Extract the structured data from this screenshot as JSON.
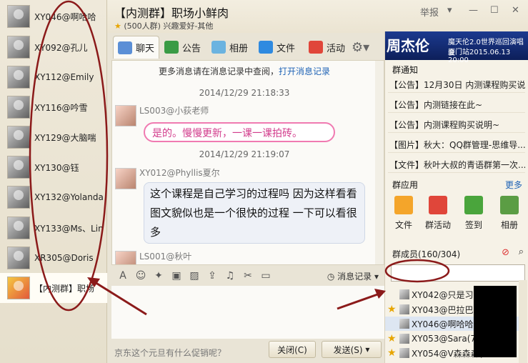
{
  "contacts": [
    {
      "name": "XY046@啊哈哈"
    },
    {
      "name": "XY092@孔儿"
    },
    {
      "name": "XY112@Emily"
    },
    {
      "name": "XY116@吟雪"
    },
    {
      "name": "XY129@大脑喘"
    },
    {
      "name": "XY130@钰"
    },
    {
      "name": "XY132@Yolanda"
    },
    {
      "name": "XY133@Ms、Lin"
    },
    {
      "name": "XR305@Doris"
    },
    {
      "name": "【内测群】职场"
    }
  ],
  "header": {
    "title": "【内测群】职场小鲜肉",
    "subtitle": "(500人群) 兴趣爱好-其他",
    "report": "举报"
  },
  "tabs": [
    {
      "label": "聊天"
    },
    {
      "label": "公告"
    },
    {
      "label": "相册"
    },
    {
      "label": "文件"
    },
    {
      "label": "活动"
    }
  ],
  "chat": {
    "history_prefix": "更多消息请在消息记录中查阅，",
    "history_link": "打开消息记录",
    "messages": [
      {
        "time": "2014/12/29 21:18:33",
        "sender": "LS003@小荻老师",
        "text": "是的。慢慢更新，一课一课拍砖。"
      },
      {
        "time": "2014/12/29 21:19:07",
        "sender": "XY012@Phyllis夏尔",
        "text": "这个课程是自己学习的过程吗 因为这样看看图文貌似也是一个很快的过程 一下可以看很多"
      },
      {
        "sender": "LS001@秋叶"
      }
    ]
  },
  "input": {
    "msg_record": "消息记录",
    "ad_text": "京东这个元旦有什么促销呢？",
    "close_label": "关闭(C)",
    "send_label": "发送(S)"
  },
  "right": {
    "banner_big": "周杰伦",
    "banner_line1": "魔天伦2.0世界巡回演唱会",
    "banner_line2": "厦门站2015.06.13 20:00",
    "notice_title": "群通知",
    "notices": [
      "【公告】12月30日 内测课程购买说明",
      "【公告】内测链接在此~",
      "【公告】内测课程购买说明~",
      "【图片】秋大：QQ群管理-思维导...",
      "【文件】秋叶大叔的青语群第一次..."
    ],
    "apps_title": "群应用",
    "more": "更多",
    "apps": [
      {
        "label": "文件"
      },
      {
        "label": "群活动"
      },
      {
        "label": "签到"
      },
      {
        "label": "相册"
      }
    ],
    "members_title": "群成员(160/304)",
    "members": [
      {
        "name": "XY042@只是习惯"
      },
      {
        "name": "XY043@巴拉巴拉"
      },
      {
        "name": "XY046@啊哈哈(15"
      },
      {
        "name": "XY053@Sara(7403"
      },
      {
        "name": "XY054@V森森森(4"
      }
    ]
  }
}
